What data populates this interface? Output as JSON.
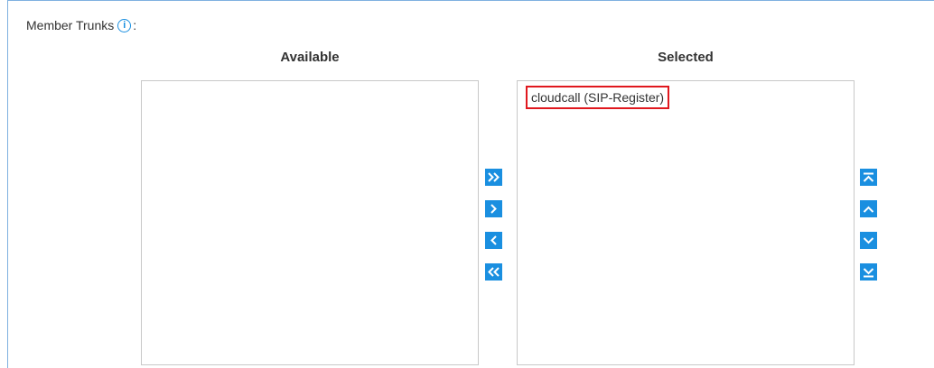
{
  "field": {
    "label": "Member Trunks",
    "colon": ":",
    "info_icon": "info-icon"
  },
  "available": {
    "heading": "Available",
    "items": []
  },
  "selected": {
    "heading": "Selected",
    "items": [
      "cloudcall (SIP-Register)"
    ]
  },
  "transfer_buttons": [
    {
      "name": "move-all-right-button",
      "icon": "double-chevron-right-icon"
    },
    {
      "name": "move-right-button",
      "icon": "chevron-right-icon"
    },
    {
      "name": "move-left-button",
      "icon": "chevron-left-icon"
    },
    {
      "name": "move-all-left-button",
      "icon": "double-chevron-left-icon"
    }
  ],
  "order_buttons": [
    {
      "name": "move-top-button",
      "icon": "move-to-top-icon"
    },
    {
      "name": "move-up-button",
      "icon": "chevron-up-icon"
    },
    {
      "name": "move-down-button",
      "icon": "chevron-down-icon"
    },
    {
      "name": "move-bottom-button",
      "icon": "move-to-bottom-icon"
    }
  ],
  "colors": {
    "accent": "#1a8fe0",
    "highlight_border": "#e0181e",
    "panel_border": "#7fb1e0"
  }
}
